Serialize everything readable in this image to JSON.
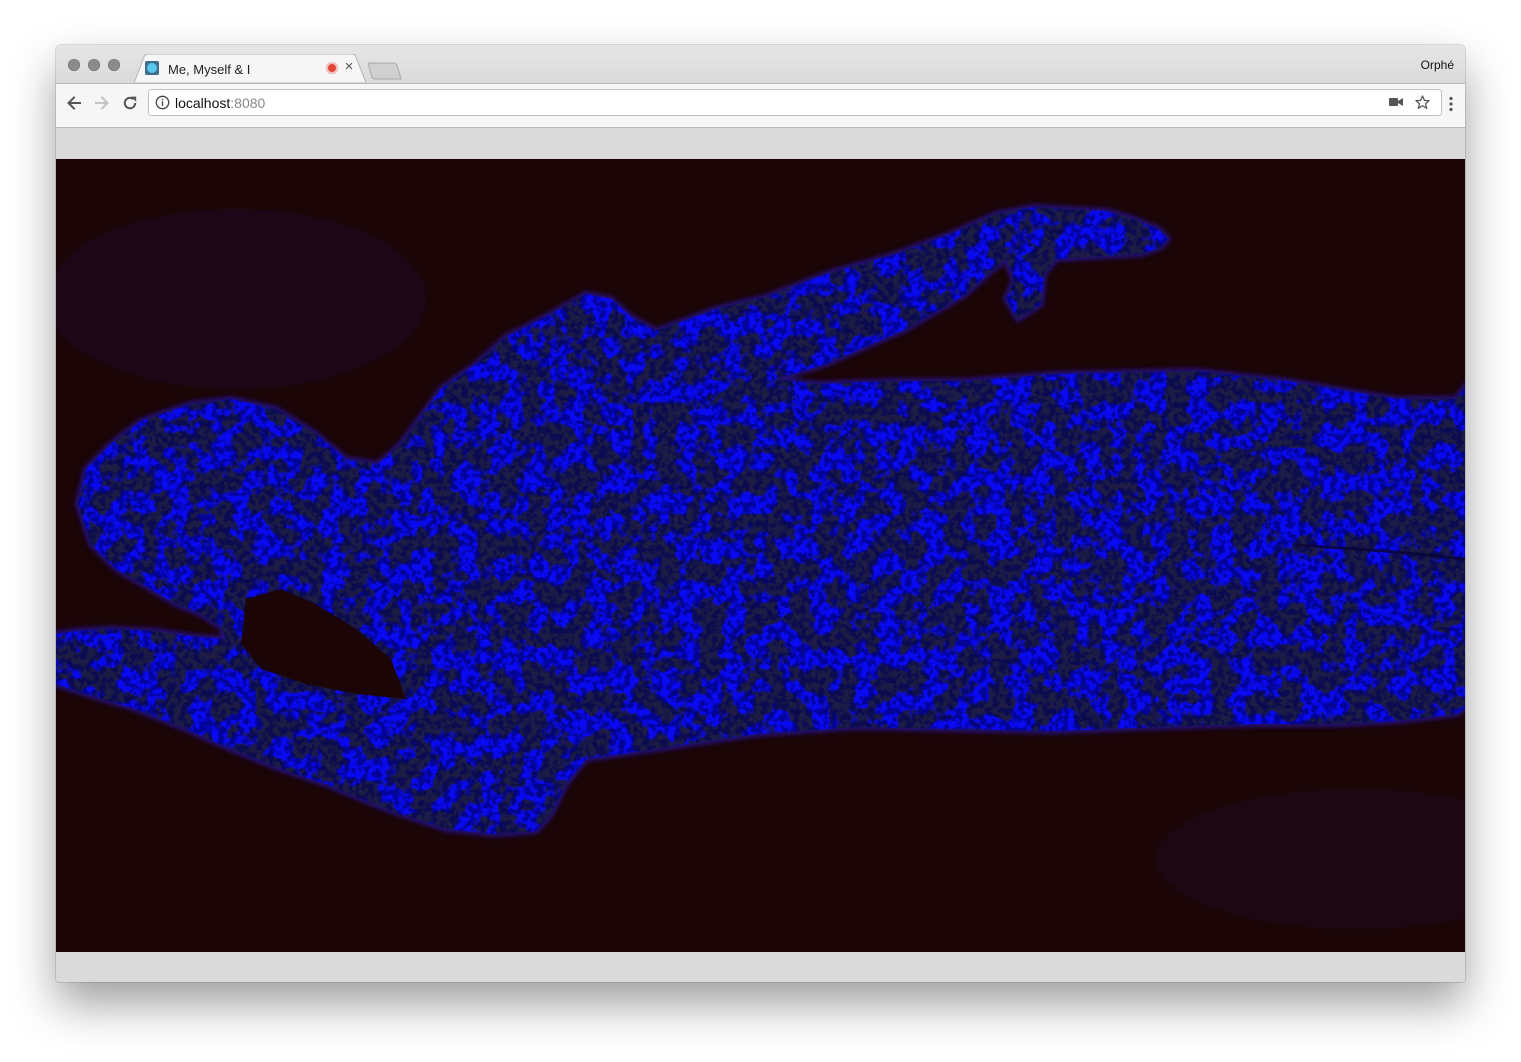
{
  "window": {
    "profile_name": "Orphé"
  },
  "tab": {
    "title": "Me, Myself & I",
    "favicon": "app-favicon",
    "recording_indicator": "record-icon",
    "close_label": "×"
  },
  "toolbar": {
    "back_icon": "arrow-left-icon",
    "forward_icon": "arrow-right-icon",
    "reload_icon": "reload-icon",
    "info_icon": "info-icon",
    "url_host": "localhost",
    "url_port": ":8080",
    "camera_icon": "video-camera-icon",
    "bookmark_icon": "star-icon",
    "menu_icon": "vertical-dots-icon"
  },
  "content": {
    "description_icon": "body-silhouette-visualization",
    "colors": {
      "background": "#1b0507",
      "figure": "#0a0af0",
      "blotches": "#030210"
    }
  }
}
